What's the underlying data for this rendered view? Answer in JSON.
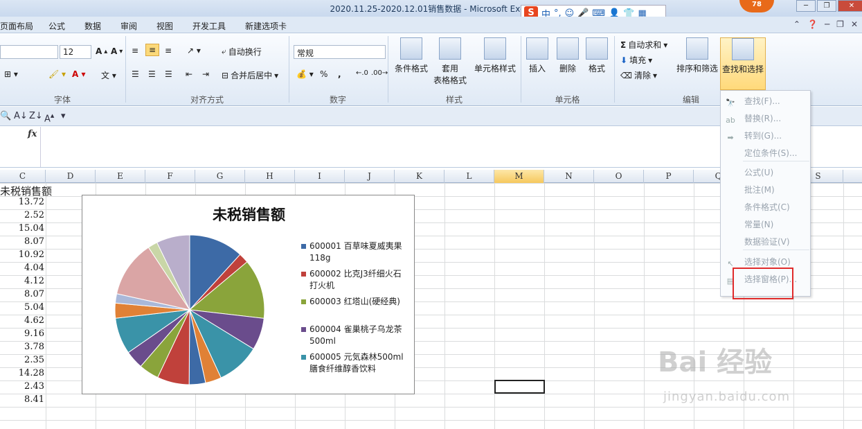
{
  "window": {
    "title": "2020.11.25-2020.12.01销售数据 - Microsoft Excel",
    "badge": "78"
  },
  "ime": {
    "logo": "S",
    "mode": "中"
  },
  "menu": {
    "tabs": [
      "页面布局",
      "公式",
      "数据",
      "审阅",
      "视图",
      "开发工具",
      "新建选项卡"
    ]
  },
  "ribbon": {
    "font_size": "12",
    "number_format": "常规",
    "wrap_text": "自动换行",
    "merge_center": "合并后居中",
    "percent": "%",
    "comma": ",",
    "cond_format": "条件格式",
    "table_format_1": "套用",
    "table_format_2": "表格格式",
    "cell_style": "单元格样式",
    "insert": "插入",
    "delete": "删除",
    "format": "格式",
    "autosum": "自动求和",
    "fill": "填充",
    "clear": "清除",
    "sort_filter": "排序和筛选",
    "find_select": "查找和选择",
    "groups": {
      "font": "字体",
      "alignment": "对齐方式",
      "number": "数字",
      "styles": "样式",
      "cells": "单元格",
      "editing": "编辑"
    }
  },
  "formula_bar": {
    "fx": "fx",
    "value": ""
  },
  "columns": [
    "C",
    "D",
    "E",
    "F",
    "G",
    "H",
    "I",
    "J",
    "K",
    "L",
    "M",
    "N",
    "O",
    "P",
    "Q",
    "R",
    "S"
  ],
  "selected_column": "M",
  "sheet": {
    "header": "未税销售额",
    "values": [
      "13.72",
      "2.52",
      "15.04",
      "8.07",
      "10.92",
      "4.04",
      "4.12",
      "8.07",
      "5.04",
      "4.62",
      "9.16",
      "3.78",
      "2.35",
      "14.28",
      "2.43",
      "8.41"
    ]
  },
  "chart_data": {
    "type": "pie",
    "title": "未税销售额",
    "categories": [
      "600001 百草味夏威夷果118g",
      "600002 比克J3纤细火石打火机",
      "600003 红塔山(硬经典)",
      "600004 雀巢桃子乌龙茶500ml",
      "600005 元気森林500ml膳食纤维醇香饮料"
    ],
    "series": [
      {
        "values": [
          13.72,
          2.52,
          15.04,
          8.07,
          10.92,
          4.04,
          4.12,
          8.07,
          5.04,
          4.62,
          9.16,
          3.78,
          2.35,
          14.28,
          2.43,
          8.41
        ]
      }
    ],
    "colors": [
      "#3d6aa6",
      "#c0413b",
      "#8aa43b",
      "#6a4c8c",
      "#3a93a8",
      "#e08136",
      "#3d6aa6",
      "#c0413b",
      "#8aa43b",
      "#6a4c8c",
      "#3a93a8",
      "#e08136",
      "#a9b8d9",
      "#daa5a5",
      "#c9d6a7",
      "#b9aecb"
    ],
    "legend_position": "right"
  },
  "legend": [
    {
      "line1": "600001 百草味夏威夷果",
      "line2": "118g",
      "color": "#3d6aa6"
    },
    {
      "line1": "600002 比克J3纤细火石",
      "line2": "打火机",
      "color": "#c0413b"
    },
    {
      "line1": "600003 红塔山(硬经典)",
      "line2": "",
      "color": "#8aa43b"
    },
    {
      "line1": "600004 雀巢桃子乌龙茶",
      "line2": "500ml",
      "color": "#6a4c8c"
    },
    {
      "line1": "600005 元気森林500ml",
      "line2": "膳食纤维醇香饮料",
      "color": "#3a93a8"
    }
  ],
  "dropdown": {
    "items": [
      "查找(F)...",
      "替换(R)...",
      "转到(G)...",
      "定位条件(S)...",
      "公式(U)",
      "批注(M)",
      "条件格式(C)",
      "常量(N)",
      "数据验证(V)",
      "选择对象(O)",
      "选择窗格(P)..."
    ]
  },
  "watermark": {
    "text": "Bai 经验",
    "url": "jingyan.baidu.com"
  }
}
